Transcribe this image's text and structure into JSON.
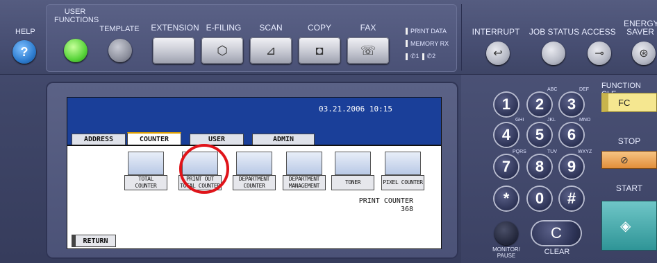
{
  "top": {
    "help": {
      "label": "HELP",
      "icon": "?"
    },
    "user_functions": {
      "line1": "USER",
      "line2": "FUNCTIONS"
    },
    "template": {
      "label": "TEMPLATE"
    },
    "mode_buttons": [
      {
        "label": "EXTENSION",
        "icon": ""
      },
      {
        "label": "e-FILING",
        "icon": "⬡"
      },
      {
        "label": "SCAN",
        "icon": "⊿"
      },
      {
        "label": "COPY",
        "icon": "◘"
      },
      {
        "label": "FAX",
        "icon": "☏"
      }
    ],
    "status": {
      "print_data": "PRINT DATA",
      "memory_rx": "MEMORY RX",
      "line1": "✆1",
      "line2": "✆2"
    },
    "interrupt": {
      "label": "INTERRUPT",
      "icon": "↩"
    },
    "job_status": {
      "label": "JOB STATUS"
    },
    "access": {
      "label": "ACCESS",
      "icon": "⊸"
    },
    "energy_saver": {
      "line1": "ENERGY",
      "line2": "SAVER",
      "icon": "⊛"
    }
  },
  "screen": {
    "datetime": "03.21.2006 10:15",
    "tabs": [
      {
        "label": "ADDRESS",
        "active": false
      },
      {
        "label": "COUNTER",
        "active": true
      },
      {
        "label": "USER",
        "active": false
      },
      {
        "label": "ADMIN",
        "active": false
      }
    ],
    "tiles": [
      {
        "line1": "TOTAL",
        "line2": "COUNTER"
      },
      {
        "line1": "PRINT OUT",
        "line2": "TOTAL COUNTER"
      },
      {
        "line1": "DEPARTMENT",
        "line2": "COUNTER"
      },
      {
        "line1": "DEPARTMENT",
        "line2": "MANAGEMENT"
      },
      {
        "line1": "TONER",
        "line2": ""
      },
      {
        "line1": "PIXEL COUNTER",
        "line2": ""
      }
    ],
    "print_counter": {
      "label": "PRINT COUNTER",
      "value": "368"
    },
    "return_label": "RETURN"
  },
  "keypad": {
    "keys": [
      "1",
      "2",
      "3",
      "4",
      "5",
      "6",
      "7",
      "8",
      "9",
      "*",
      "0",
      "#"
    ],
    "subs": {
      "2": "ABC",
      "3": "DEF",
      "4": "GHI",
      "5": "JKL",
      "6": "MNO",
      "7": "PQRS",
      "8": "TUV",
      "9": "WXYZ"
    },
    "monitor": {
      "line1": "MONITOR/",
      "line2": "PAUSE"
    },
    "clear": {
      "label": "CLEAR",
      "key": "C"
    }
  },
  "right": {
    "function_clear": "FUNCTION CLE",
    "fc": "FC",
    "stop": "STOP",
    "stop_icon": "⊘",
    "start": "START",
    "start_icon": "◈"
  },
  "colors": {
    "screen_blue": "#1a3f99",
    "highlight_red": "#e0141a",
    "start_teal": "#2f9597"
  }
}
